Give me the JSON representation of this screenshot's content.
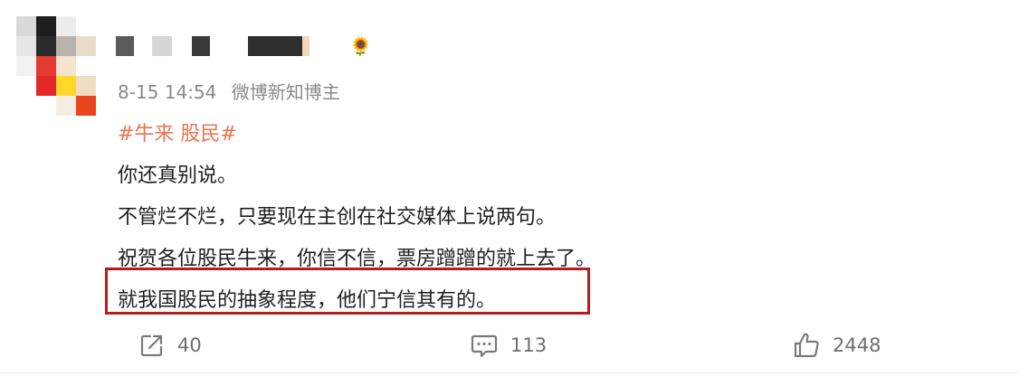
{
  "post": {
    "author": {
      "name_obscured": "",
      "emoji": "🌻"
    },
    "timestamp": "8-15 14:54",
    "badge": "微博新知博主",
    "hashtag": "#牛来 股民#",
    "lines": [
      "你还真别说。",
      "不管烂不烂，只要现在主创在社交媒体上说两句。",
      "祝贺各位股民牛来，你信不信，票房蹭蹭的就上去了。",
      "就我国股民的抽象程度，他们宁信其有的。"
    ],
    "actions": {
      "share": {
        "icon": "share-icon",
        "count": "40"
      },
      "comment": {
        "icon": "comment-icon",
        "count": "113"
      },
      "like": {
        "icon": "thumbs-up-icon",
        "count": "2448"
      }
    },
    "colors": {
      "hashtag": "#eb7350",
      "highlight_border": "#b81c1c",
      "meta_text": "#8a8a8a"
    }
  }
}
